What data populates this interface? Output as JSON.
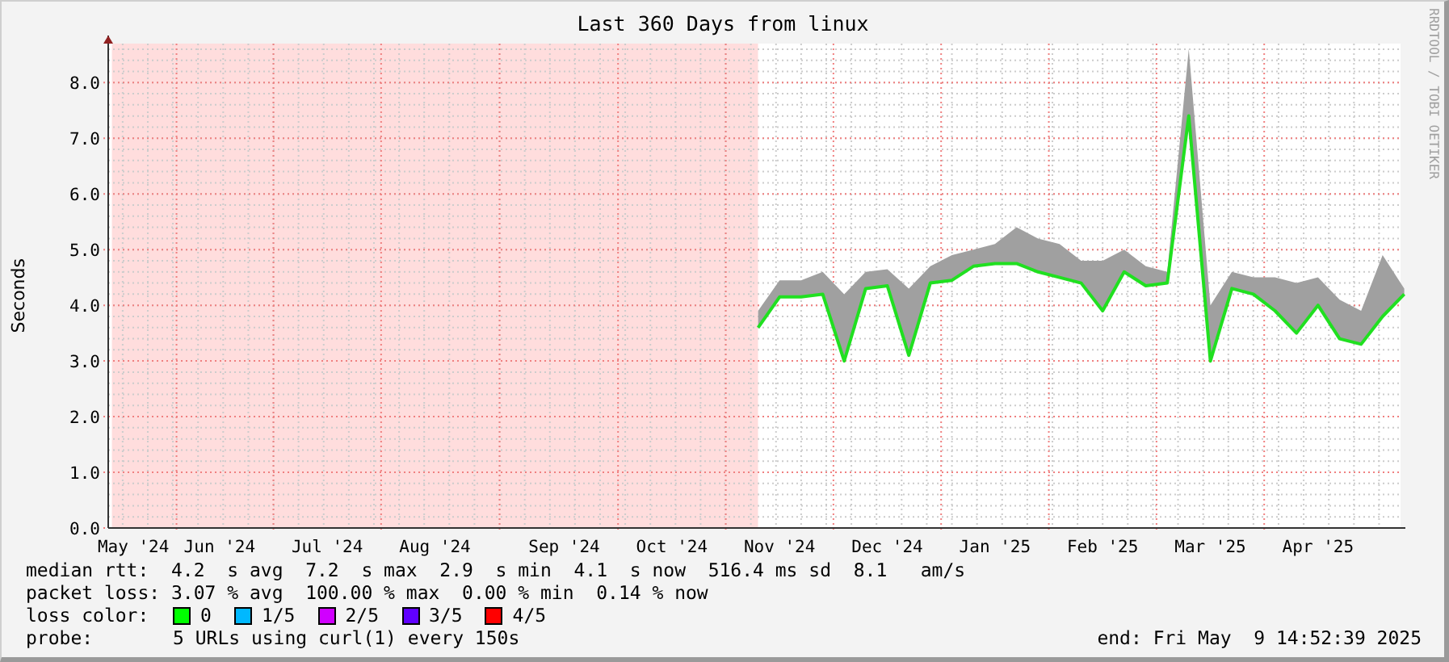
{
  "title": "Last 360 Days from linux",
  "credit": "RRDTOOL / TOBI OETIKER",
  "chart_data": {
    "type": "line",
    "grid": true,
    "ylabel": "Seconds",
    "ylim": [
      0,
      8.7
    ],
    "categories": [
      null,
      "May '24",
      null,
      null,
      null,
      "Jun '24",
      null,
      null,
      null,
      null,
      "Jul '24",
      null,
      null,
      null,
      null,
      "Aug '24",
      null,
      null,
      null,
      null,
      null,
      "Sep '24",
      null,
      null,
      null,
      null,
      "Oct '24",
      null,
      null,
      null,
      null,
      "Nov '24",
      null,
      null,
      null,
      null,
      "Dec '24",
      null,
      null,
      null,
      null,
      "Jan '25",
      null,
      null,
      null,
      null,
      "Feb '25",
      null,
      null,
      null,
      null,
      "Mar '25",
      null,
      null,
      null,
      null,
      "Apr '25",
      null,
      null,
      null,
      null
    ],
    "yticks": [
      {
        "value": 0,
        "label": "0.0"
      },
      {
        "value": 1,
        "label": "1.0"
      },
      {
        "value": 2,
        "label": "2.0"
      },
      {
        "value": 3,
        "label": "3.0"
      },
      {
        "value": 4,
        "label": "4.0"
      },
      {
        "value": 5,
        "label": "5.0"
      },
      {
        "value": 6,
        "label": "6.0"
      },
      {
        "value": 7,
        "label": "7.0"
      },
      {
        "value": 8,
        "label": "8.0"
      }
    ],
    "series": [
      {
        "color": "#20e020",
        "values": [
          null,
          null,
          null,
          null,
          null,
          null,
          null,
          null,
          null,
          null,
          null,
          null,
          null,
          null,
          null,
          null,
          null,
          null,
          null,
          null,
          null,
          null,
          null,
          null,
          null,
          null,
          null,
          null,
          null,
          null,
          3.6,
          4.15,
          4.15,
          4.2,
          3.0,
          4.3,
          4.35,
          3.1,
          4.4,
          4.45,
          4.7,
          4.75,
          4.75,
          4.6,
          4.5,
          4.4,
          3.9,
          4.6,
          4.35,
          4.4,
          7.4,
          3.0,
          4.3,
          4.2,
          3.9,
          3.5,
          4.0,
          3.4,
          3.3,
          3.8,
          4.2
        ]
      },
      {
        "type": "area",
        "color": "#a0a0a0",
        "values": [
          null,
          null,
          null,
          null,
          null,
          null,
          null,
          null,
          null,
          null,
          null,
          null,
          null,
          null,
          null,
          null,
          null,
          null,
          null,
          null,
          null,
          null,
          null,
          null,
          null,
          null,
          null,
          null,
          null,
          null,
          3.9,
          4.45,
          4.45,
          4.6,
          4.2,
          4.6,
          4.65,
          4.3,
          4.7,
          4.9,
          5.0,
          5.1,
          5.4,
          5.2,
          5.1,
          4.8,
          4.8,
          5.0,
          4.7,
          4.6,
          8.6,
          4.0,
          4.6,
          4.5,
          4.5,
          4.4,
          4.5,
          4.1,
          3.9,
          4.9,
          4.3
        ]
      }
    ]
  },
  "legend": {
    "median_rtt": "median rtt:  4.2  s avg  7.2  s max  2.9  s min  4.1  s now  516.4 ms sd  8.1   am/s",
    "packet_loss": "packet loss: 3.07 % avg  100.00 % max  0.00 % min  0.14 % now",
    "loss_color_label": "loss color:",
    "loss_colors": [
      {
        "label": "0",
        "color": "#00ff00"
      },
      {
        "label": "1/5",
        "color": "#00b8ff"
      },
      {
        "label": "2/5",
        "color": "#d000ff"
      },
      {
        "label": "3/5",
        "color": "#6000ff"
      },
      {
        "label": "4/5",
        "color": "#ff0000"
      }
    ],
    "probe_label": "probe:",
    "probe": "5 URLs using curl(1) every 150s",
    "end": "end: Fri May  9 14:52:39 2025"
  }
}
